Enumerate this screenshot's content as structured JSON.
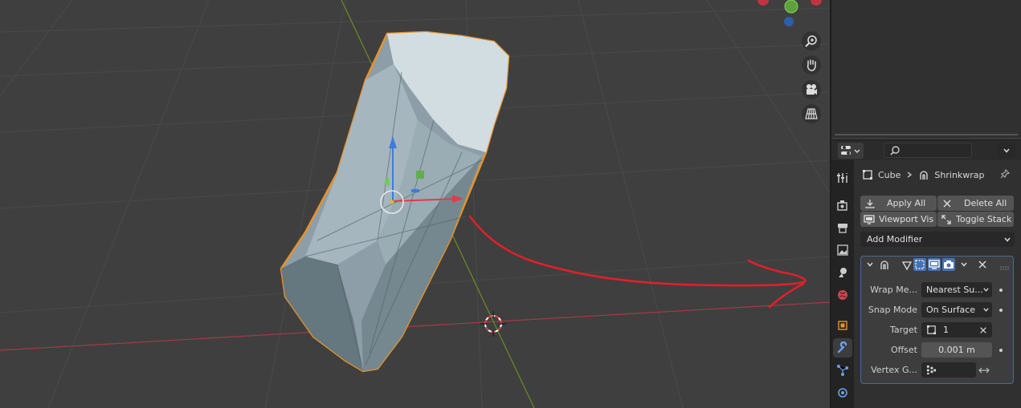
{
  "properties": {
    "breadcrumb": {
      "object": "Cube",
      "modifier": "Shrinkwrap"
    },
    "toolbar": {
      "apply_all": "Apply All",
      "delete_all": "Delete All",
      "viewport_vis": "Viewport Vis",
      "toggle_stack": "Toggle Stack"
    },
    "add_modifier": "Add Modifier",
    "modifier": {
      "wrap_method_label": "Wrap Me...",
      "wrap_method_value": "Nearest Su...",
      "snap_mode_label": "Snap Mode",
      "snap_mode_value": "On Surface",
      "target_label": "Target",
      "target_value": "1",
      "offset_label": "Offset",
      "offset_value": "0.001 m",
      "vertex_group_label": "Vertex G..."
    }
  },
  "icons": {
    "tabs": [
      "tool-icon",
      "render-icon",
      "output-icon",
      "view-layer-icon",
      "scene-icon",
      "world-icon",
      "object-icon",
      "modifier-wrench-icon",
      "particles-icon",
      "physics-icon"
    ]
  },
  "colors": {
    "selection_outline": "#e8922a",
    "annotation": "#e0202a",
    "x_axis": "#a33c45",
    "y_axis": "#6b8e23",
    "accent": "#4772b3"
  }
}
